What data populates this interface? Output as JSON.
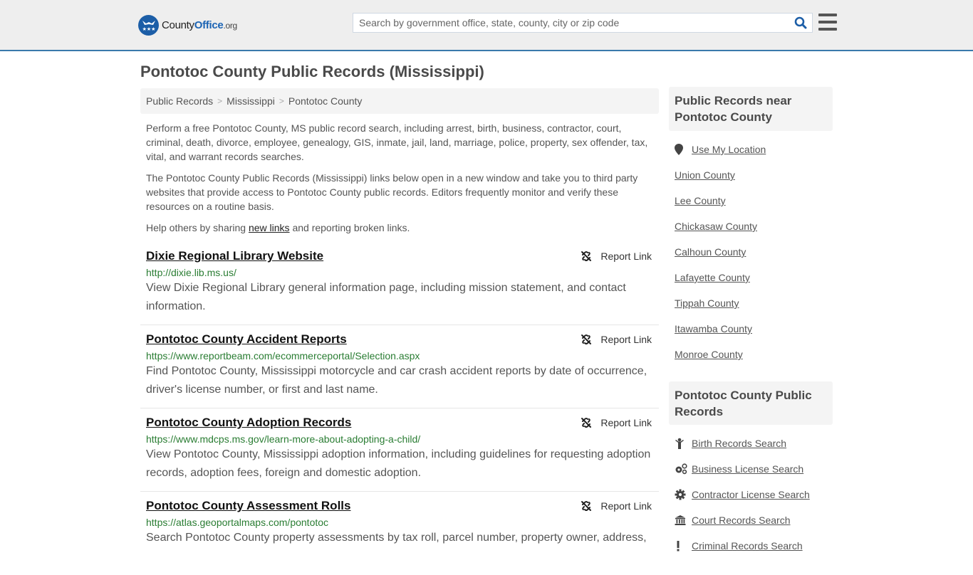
{
  "header": {
    "logo": {
      "name_part1": "County",
      "name_part2": "Office",
      "name_part3": ".org"
    },
    "search": {
      "placeholder": "Search by government office, state, county, city or zip code",
      "value": ""
    },
    "brand_color": "#1c5ea7",
    "accent_border": "#3a7aab"
  },
  "page": {
    "title": "Pontotoc County Public Records (Mississippi)",
    "breadcrumb": [
      {
        "label": "Public Records"
      },
      {
        "label": "Mississippi"
      },
      {
        "label": "Pontotoc County"
      }
    ],
    "breadcrumb_separator": ">",
    "intro": {
      "p1": "Perform a free Pontotoc County, MS public record search, including arrest, birth, business, contractor, court, criminal, death, divorce, employee, genealogy, GIS, inmate, jail, land, marriage, police, property, sex offender, tax, vital, and warrant records searches.",
      "p2": "The Pontotoc County Public Records (Mississippi) links below open in a new window and take you to third party websites that provide access to Pontotoc County public records. Editors frequently monitor and verify these resources on a routine basis.",
      "p3_before": "Help others by sharing ",
      "p3_link": "new links",
      "p3_after": " and reporting broken links."
    }
  },
  "records": [
    {
      "title": "Dixie Regional Library Website",
      "url": "http://dixie.lib.ms.us/",
      "description": "View Dixie Regional Library general information page, including mission statement, and contact information.",
      "report_label": "Report Link"
    },
    {
      "title": "Pontotoc County Accident Reports",
      "url": "https://www.reportbeam.com/ecommerceportal/Selection.aspx",
      "description": "Find Pontotoc County, Mississippi motorcycle and car crash accident reports by date of occurrence, driver's license number, or first and last name.",
      "report_label": "Report Link"
    },
    {
      "title": "Pontotoc County Adoption Records",
      "url": "https://www.mdcps.ms.gov/learn-more-about-adopting-a-child/",
      "description": "View Pontotoc County, Mississippi adoption information, including guidelines for requesting adoption records, adoption fees, foreign and domestic adoption.",
      "report_label": "Report Link"
    },
    {
      "title": "Pontotoc County Assessment Rolls",
      "url": "https://atlas.geoportalmaps.com/pontotoc",
      "description": "Search Pontotoc County property assessments by tax roll, parcel number, property owner, address,",
      "report_label": "Report Link"
    }
  ],
  "sidebar": {
    "nearby": {
      "heading": "Public Records near Pontotoc County",
      "use_location": {
        "label": "Use My Location",
        "icon": "map-marker-icon"
      },
      "items": [
        {
          "label": "Union County"
        },
        {
          "label": "Lee County"
        },
        {
          "label": "Chickasaw County"
        },
        {
          "label": "Calhoun County"
        },
        {
          "label": "Lafayette County"
        },
        {
          "label": "Tippah County"
        },
        {
          "label": "Itawamba County"
        },
        {
          "label": "Monroe County"
        }
      ]
    },
    "county_records": {
      "heading": "Pontotoc County Public Records",
      "items": [
        {
          "label": "Birth Records Search",
          "icon": "child-icon"
        },
        {
          "label": "Business License Search",
          "icon": "cogs-icon"
        },
        {
          "label": "Contractor License Search",
          "icon": "gear-icon"
        },
        {
          "label": "Court Records Search",
          "icon": "courthouse-icon"
        },
        {
          "label": "Criminal Records Search",
          "icon": "exclamation-icon"
        }
      ]
    }
  }
}
